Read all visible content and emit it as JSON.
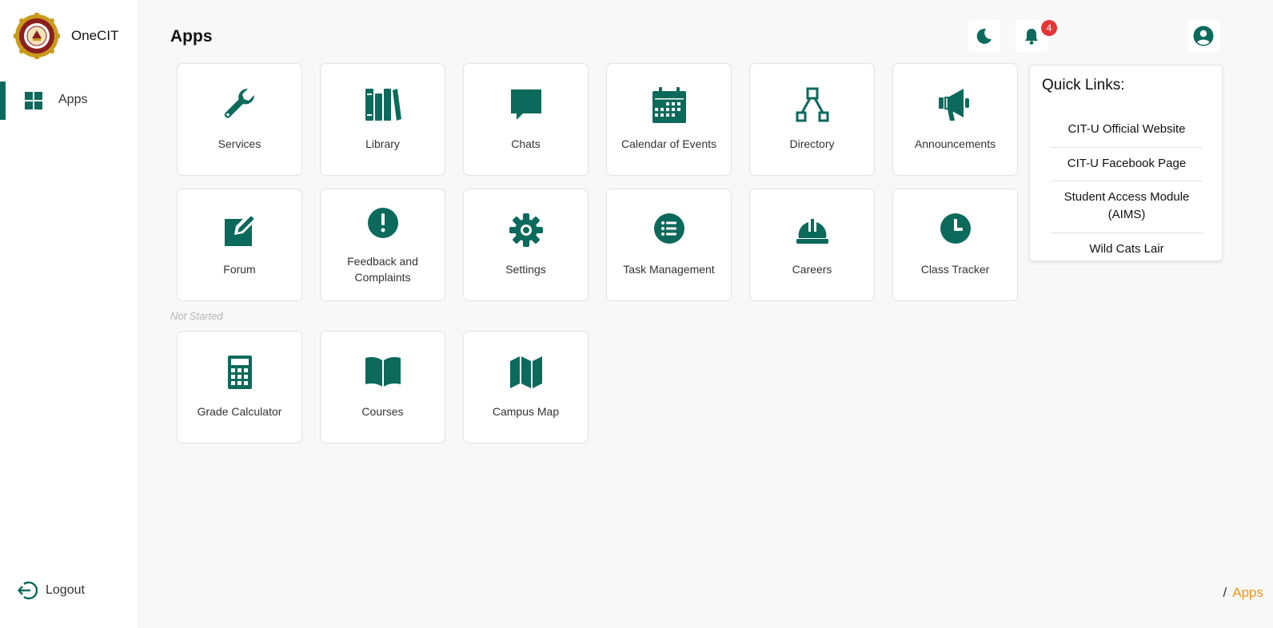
{
  "colors": {
    "accent": "#0b6a5c",
    "badge": "#e53535",
    "breadcrumb_active": "#f0951a"
  },
  "brand": {
    "name": "OneCIT",
    "logo": "institute-seal-logo"
  },
  "sidebar": {
    "items": [
      {
        "label": "Apps",
        "icon": "grid-icon",
        "active": true
      }
    ],
    "logout_label": "Logout"
  },
  "header": {
    "title": "Apps",
    "notification_count": "4"
  },
  "apps": {
    "row1": [
      {
        "label": "Services",
        "icon": "wrench-icon"
      },
      {
        "label": "Library",
        "icon": "books-icon"
      },
      {
        "label": "Chats",
        "icon": "chat-bubble-icon"
      },
      {
        "label": "Calendar of Events",
        "icon": "calendar-icon"
      },
      {
        "label": "Directory",
        "icon": "sitemap-icon"
      },
      {
        "label": "Announcements",
        "icon": "megaphone-icon"
      }
    ],
    "row2": [
      {
        "label": "Forum",
        "icon": "edit-square-icon"
      },
      {
        "label": "Feedback and Complaints",
        "icon": "exclamation-circle-icon"
      },
      {
        "label": "Settings",
        "icon": "gear-icon"
      },
      {
        "label": "Task Management",
        "icon": "list-circle-icon"
      },
      {
        "label": "Careers",
        "icon": "hard-hat-icon"
      },
      {
        "label": "Class Tracker",
        "icon": "clock-icon"
      }
    ],
    "not_started_label": "Not Started",
    "row3": [
      {
        "label": "Grade Calculator",
        "icon": "calculator-icon"
      },
      {
        "label": "Courses",
        "icon": "open-book-icon"
      },
      {
        "label": "Campus Map",
        "icon": "folded-map-icon"
      }
    ]
  },
  "quick_links": {
    "title": "Quick Links:",
    "links": [
      "CIT-U Official Website",
      "CIT-U Facebook Page",
      "Student Access Module (AIMS)",
      "Wild Cats Lair"
    ]
  },
  "breadcrumb": {
    "separator": "/",
    "current": "Apps"
  }
}
